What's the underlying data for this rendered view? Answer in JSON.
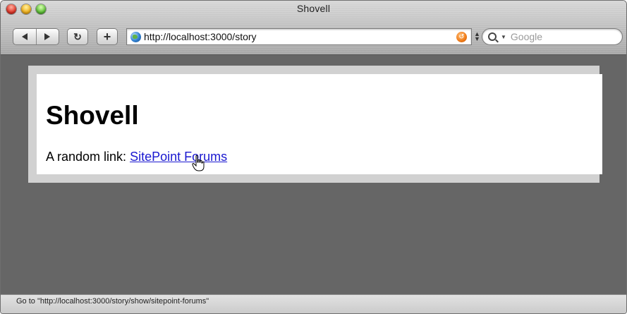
{
  "window": {
    "title": "Shovell"
  },
  "toolbar": {
    "back_icon": "back-arrow",
    "forward_icon": "forward-arrow",
    "reload_label": "C",
    "add_label": "+",
    "url": "http://localhost:3000/story",
    "search_placeholder": "Google"
  },
  "page": {
    "heading": "Shovell",
    "link_prefix": "A random link: ",
    "link_text": "SitePoint Forums"
  },
  "status": {
    "text": "Go to \"http://localhost:3000/story/show/sitepoint-forums\""
  },
  "colors": {
    "page_background": "#666666",
    "card_border": "#d1d1d1",
    "link": "#1a18d0"
  }
}
